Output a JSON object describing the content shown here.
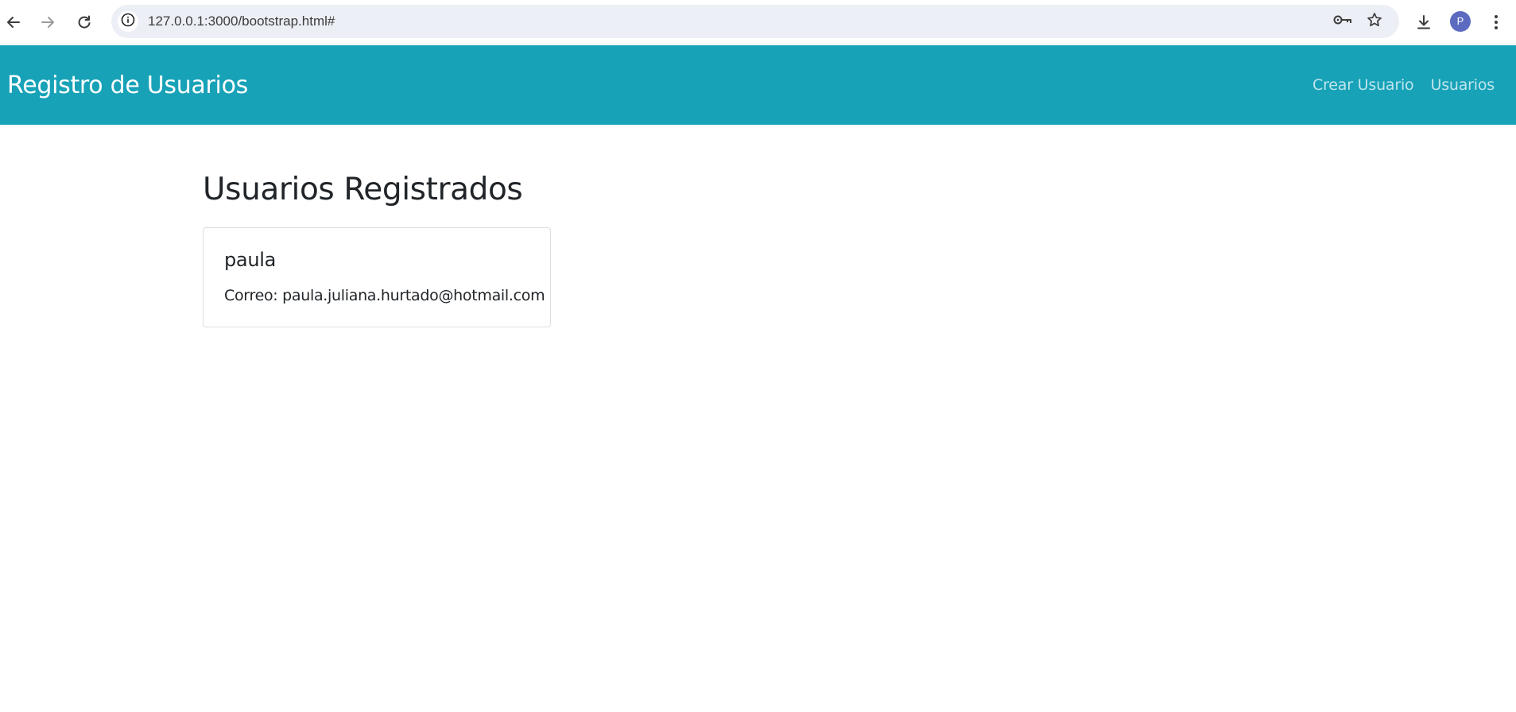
{
  "browser": {
    "url": "127.0.0.1:3000/bootstrap.html#",
    "profile_initial": "P",
    "icons": [
      "back-arrow-icon",
      "forward-arrow-icon",
      "reload-icon",
      "site-info-icon",
      "password-key-icon",
      "bookmark-star-icon",
      "download-icon",
      "menu-kebab-icon"
    ]
  },
  "navbar": {
    "brand": "Registro de Usuarios",
    "links": [
      "Crear Usuario",
      "Usuarios"
    ],
    "color": "#17a2b8"
  },
  "main": {
    "title": "Usuarios Registrados",
    "users": [
      {
        "name": "paula",
        "email_label": "Correo:",
        "email": "paula.juliana.hurtado@hotmail.com"
      }
    ]
  }
}
